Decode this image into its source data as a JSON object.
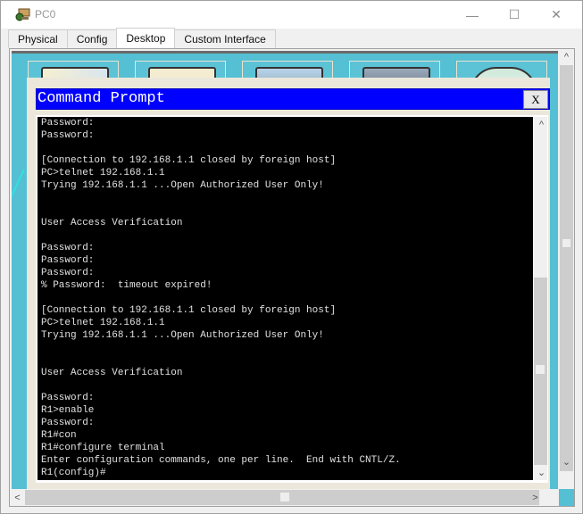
{
  "window": {
    "title": "PC0",
    "app_icon": "packet-tracer-pc-icon",
    "controls": [
      "minimize",
      "maximize",
      "close"
    ]
  },
  "tabs": [
    {
      "label": "Physical",
      "active": false
    },
    {
      "label": "Config",
      "active": false
    },
    {
      "label": "Desktop",
      "active": true
    },
    {
      "label": "Custom Interface",
      "active": false
    }
  ],
  "dialog": {
    "title": "Command Prompt",
    "close_label": "X"
  },
  "terminal": {
    "lines": [
      "Password:",
      "Password:",
      "",
      "[Connection to 192.168.1.1 closed by foreign host]",
      "PC>telnet 192.168.1.1",
      "Trying 192.168.1.1 ...Open Authorized User Only!",
      "",
      "",
      "User Access Verification",
      "",
      "Password:",
      "Password:",
      "Password:",
      "% Password:  timeout expired!",
      "",
      "[Connection to 192.168.1.1 closed by foreign host]",
      "PC>telnet 192.168.1.1",
      "Trying 192.168.1.1 ...Open Authorized User Only!",
      "",
      "",
      "User Access Verification",
      "",
      "Password:",
      "R1>enable",
      "Password:",
      "R1#con",
      "R1#configure terminal",
      "Enter configuration commands, one per line.  End with CNTL/Z.",
      "R1(config)#"
    ]
  },
  "desktop_icons": [
    "ip-configuration-icon",
    "dial-up-icon",
    "terminal-icon",
    "command-prompt-icon",
    "web-browser-icon"
  ],
  "colors": {
    "desktop_bg": "#55bfd4",
    "dialog_title_bg": "#0000ff",
    "terminal_bg": "#000000",
    "terminal_fg": "#e0e0e0"
  }
}
